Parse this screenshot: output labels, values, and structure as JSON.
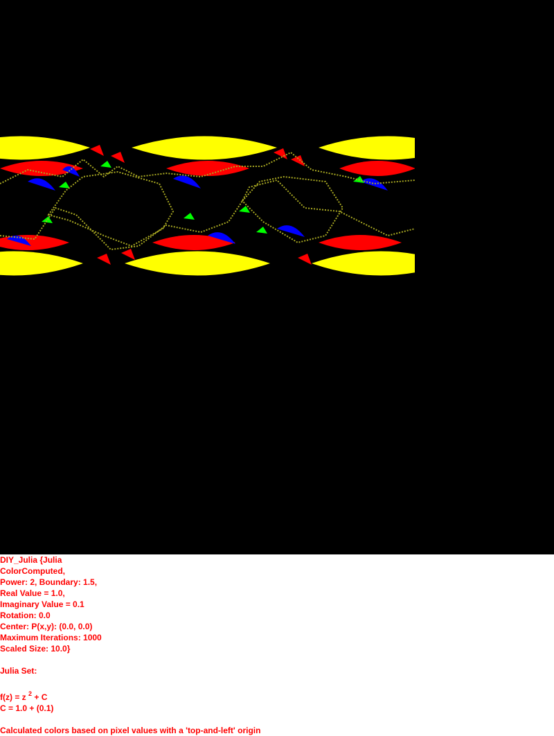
{
  "canvas": {
    "background_color": "#000000",
    "fractal_colors": {
      "yellow": "#ffff00",
      "red": "#ff0000",
      "blue": "#0000ff",
      "green": "#00ff00"
    }
  },
  "info": {
    "text_color": "#ff0000",
    "lines": [
      "DIY_Julia {Julia",
      "ColorComputed,",
      "Power: 2, Boundary: 1.5,",
      "Real Value = 1.0,",
      "Imaginary Value = 0.1",
      "Rotation: 0.0",
      "Center: P(x,y): (0.0, 0.0)",
      "Maximum Iterations: 1000",
      "Scaled Size: 10.0}"
    ],
    "heading": "Julia Set:",
    "formula_prefix": "f(z) = z",
    "formula_power": "2",
    "formula_suffix": " + C",
    "constant": "C = 1.0 + (0.1)",
    "footer": "Calculated colors based on pixel values with a 'top-and-left' origin"
  }
}
